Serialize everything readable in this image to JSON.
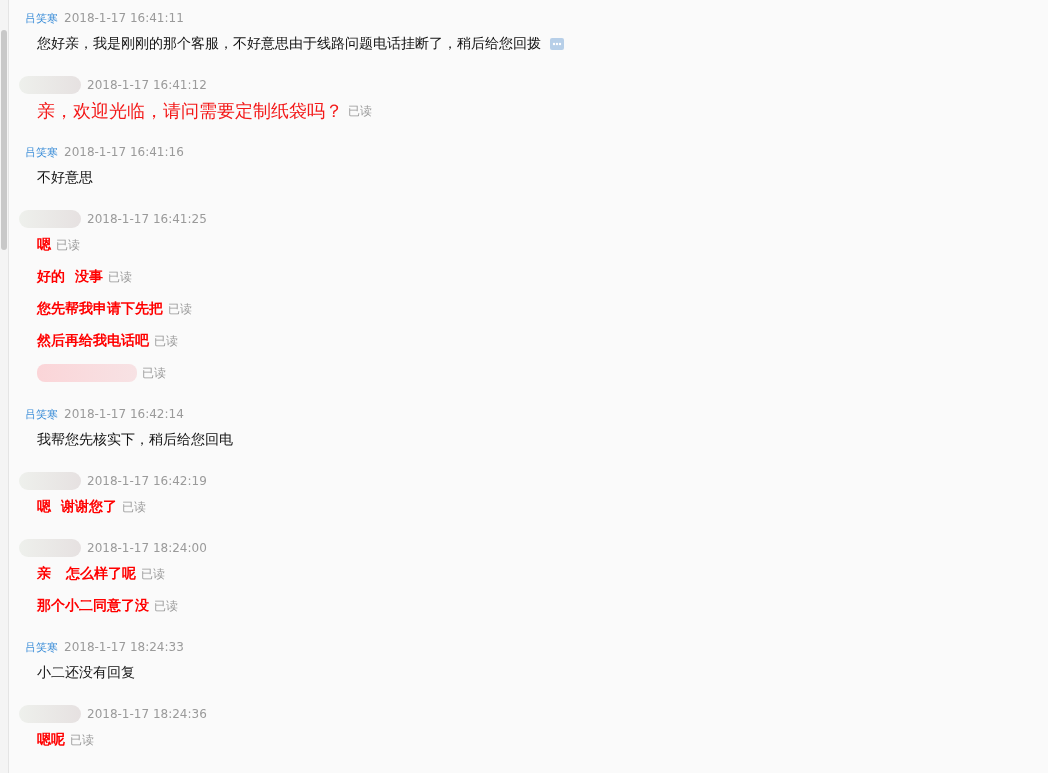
{
  "groups": [
    {
      "sender": {
        "kind": "agent",
        "name": "吕笑寒"
      },
      "time": "2018-1-17 16:41:11",
      "messages": [
        {
          "kind": "plain",
          "text": "您好亲，我是刚刚的那个客服，不好意思由于线路问题电话挂断了，稍后给您回拨",
          "more": true
        }
      ]
    },
    {
      "sender": {
        "kind": "customer"
      },
      "time": "2018-1-17 16:41:12",
      "messages": [
        {
          "kind": "large-red",
          "text": "亲，欢迎光临，请问需要定制纸袋吗？",
          "status": "已读"
        }
      ]
    },
    {
      "sender": {
        "kind": "agent",
        "name": "吕笑寒"
      },
      "time": "2018-1-17 16:41:16",
      "messages": [
        {
          "kind": "plain",
          "text": "不好意思"
        }
      ]
    },
    {
      "sender": {
        "kind": "customer"
      },
      "time": "2018-1-17 16:41:25",
      "messages": [
        {
          "kind": "bold-red",
          "text": "嗯",
          "status": "已读"
        },
        {
          "kind": "bold-red",
          "text": "好的  没事",
          "status": "已读"
        },
        {
          "kind": "bold-red",
          "text": "您先帮我申请下先把",
          "status": "已读"
        },
        {
          "kind": "bold-red",
          "text": "然后再给我电话吧",
          "status": "已读"
        },
        {
          "kind": "redacted",
          "status": "已读"
        }
      ]
    },
    {
      "sender": {
        "kind": "agent",
        "name": "吕笑寒"
      },
      "time": "2018-1-17 16:42:14",
      "messages": [
        {
          "kind": "plain",
          "text": "我帮您先核实下，稍后给您回电"
        }
      ]
    },
    {
      "sender": {
        "kind": "customer"
      },
      "time": "2018-1-17 16:42:19",
      "messages": [
        {
          "kind": "bold-red",
          "text": "嗯  谢谢您了",
          "status": "已读"
        }
      ]
    },
    {
      "sender": {
        "kind": "customer"
      },
      "time": "2018-1-17 18:24:00",
      "messages": [
        {
          "kind": "bold-red",
          "text": "亲   怎么样了呢",
          "status": "已读"
        },
        {
          "kind": "bold-red",
          "text": "那个小二同意了没",
          "status": "已读"
        }
      ]
    },
    {
      "sender": {
        "kind": "agent",
        "name": "吕笑寒"
      },
      "time": "2018-1-17 18:24:33",
      "messages": [
        {
          "kind": "plain",
          "text": "小二还没有回复"
        }
      ]
    },
    {
      "sender": {
        "kind": "customer"
      },
      "time": "2018-1-17 18:24:36",
      "messages": [
        {
          "kind": "bold-red",
          "text": "嗯呢",
          "status": "已读"
        }
      ]
    }
  ]
}
